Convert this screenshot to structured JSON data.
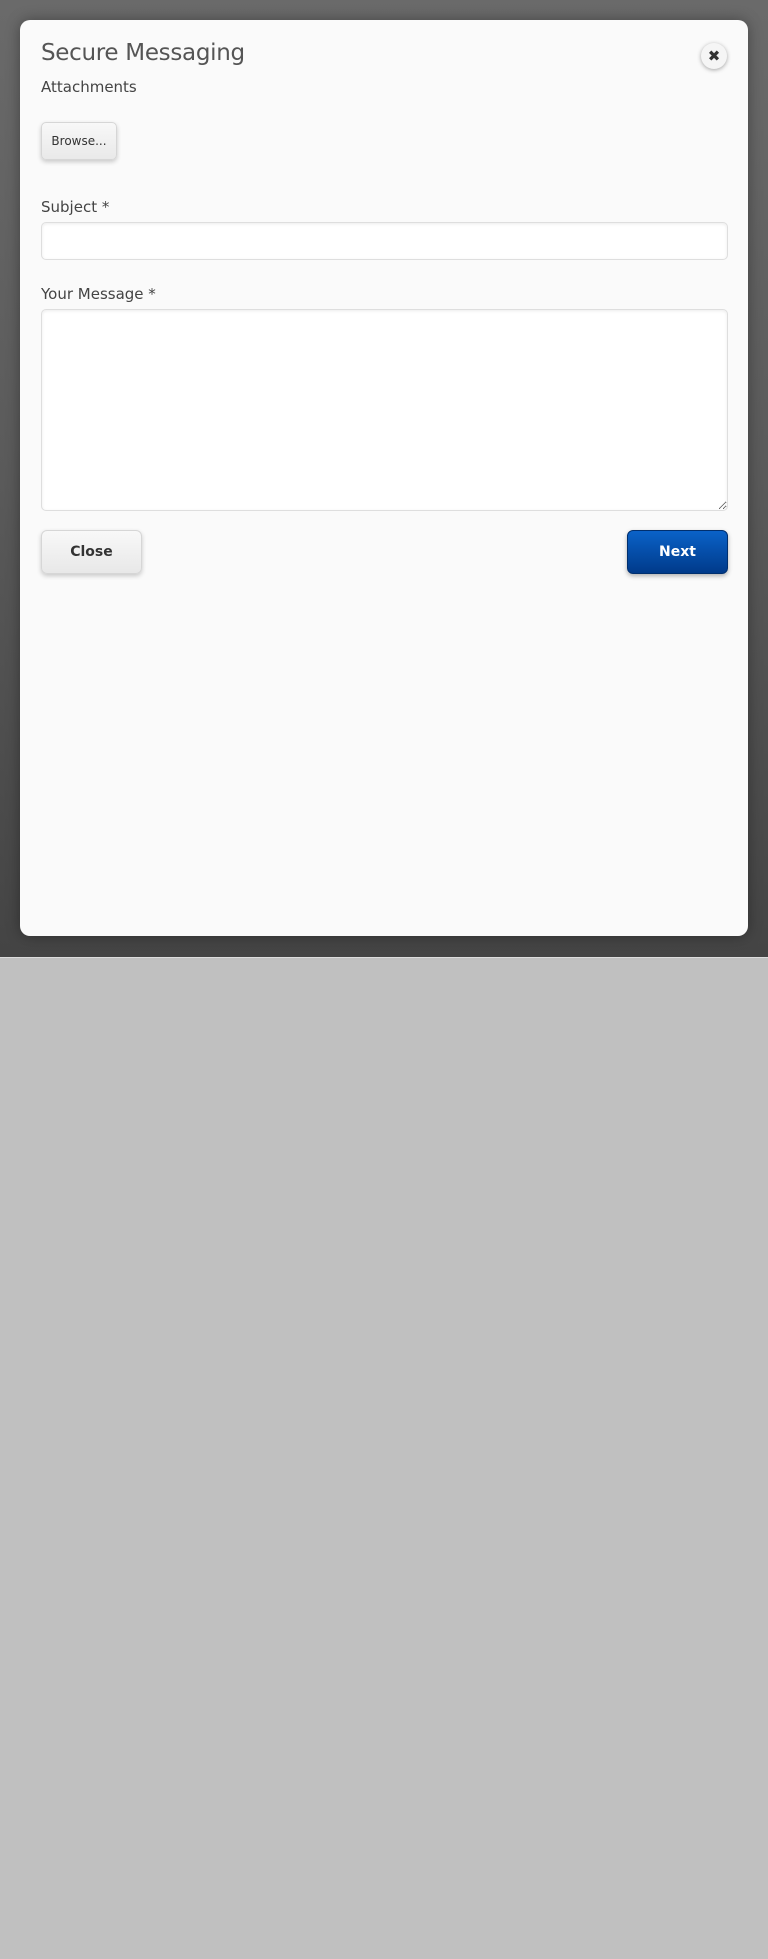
{
  "modal": {
    "title": "Secure Messaging",
    "close_icon": "close-x-icon",
    "close_glyph": "✖"
  },
  "form": {
    "attachments_label": "Attachments",
    "browse_label": "Browse...",
    "subject_label": "Subject *",
    "subject_value": "",
    "message_label": "Your Message *",
    "message_value": ""
  },
  "actions": {
    "close_label": "Close",
    "next_label": "Next"
  },
  "colors": {
    "primary": "#0047a8",
    "modal_bg": "#fafafa",
    "page_bg": "#c0c0c0"
  }
}
